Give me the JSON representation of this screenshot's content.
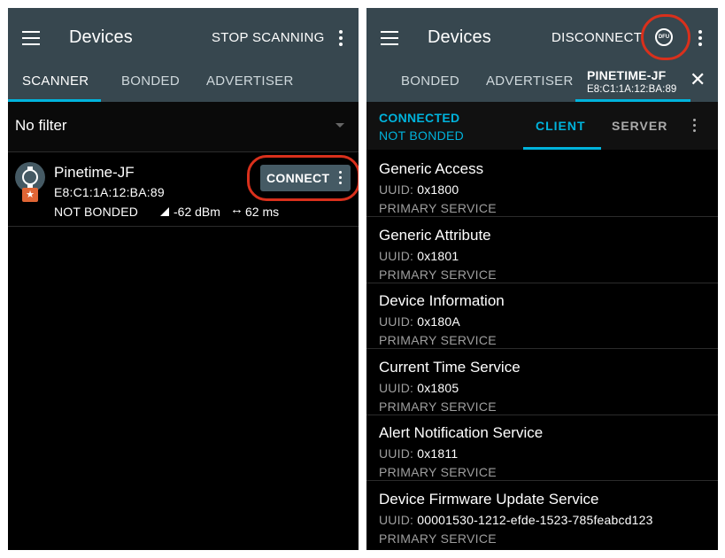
{
  "left": {
    "app_title": "Devices",
    "stop_scanning": "STOP SCANNING",
    "tabs": [
      "SCANNER",
      "BONDED",
      "ADVERTISER"
    ],
    "filter": "No filter",
    "device": {
      "name": "Pinetime-JF",
      "mac": "E8:C1:1A:12:BA:89",
      "bond_state": "NOT BONDED",
      "rssi": "-62 dBm",
      "interval": "62 ms",
      "interval_icon": "↔",
      "badge_icon": "★",
      "connect_label": "CONNECT"
    }
  },
  "right": {
    "app_title": "Devices",
    "disconnect": "DISCONNECT",
    "dfu_icon": "DFU",
    "tabs": [
      "BONDED",
      "ADVERTISER"
    ],
    "device_tab": {
      "name": "PINETIME-JF",
      "mac": "E8:C1:1A:12:BA:89"
    },
    "close_icon": "✕",
    "status": {
      "connection": "CONNECTED",
      "bond": "NOT BONDED"
    },
    "subtabs": [
      "CLIENT",
      "SERVER"
    ],
    "uuid_label": "UUID:",
    "services": [
      {
        "name": "Generic Access",
        "uuid": "0x1800",
        "type": "PRIMARY SERVICE"
      },
      {
        "name": "Generic Attribute",
        "uuid": "0x1801",
        "type": "PRIMARY SERVICE"
      },
      {
        "name": "Device Information",
        "uuid": "0x180A",
        "type": "PRIMARY SERVICE"
      },
      {
        "name": "Current Time Service",
        "uuid": "0x1805",
        "type": "PRIMARY SERVICE"
      },
      {
        "name": "Alert Notification Service",
        "uuid": "0x1811",
        "type": "PRIMARY SERVICE"
      },
      {
        "name": "Device Firmware Update Service",
        "uuid": "00001530-1212-efde-1523-785feabcd123",
        "type": "PRIMARY SERVICE"
      }
    ]
  },
  "colors": {
    "toolbar": "#37474f",
    "accent": "#00b3dc",
    "highlight": "#d9301c",
    "badge": "#e06535",
    "connect_button": "#455a64"
  }
}
